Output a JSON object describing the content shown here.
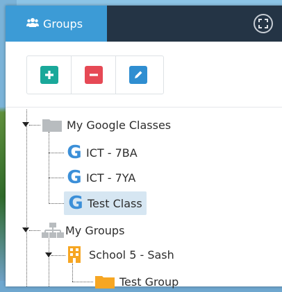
{
  "header": {
    "tab_label": "Groups",
    "tab_icon": "users-icon",
    "fullscreen_icon": "fullscreen-icon"
  },
  "toolbar": {
    "add_icon": "plus-icon",
    "remove_icon": "minus-icon",
    "edit_icon": "pencil-icon"
  },
  "tree": {
    "google_classes": {
      "label": "My Google Classes",
      "children": [
        "ICT - 7BA",
        "ICT - 7YA",
        "Test Class"
      ],
      "selected": "Test Class"
    },
    "groups": {
      "label": "My Groups",
      "school": {
        "label": "School 5 - Sash",
        "children": [
          "Test Group"
        ]
      }
    }
  },
  "colors": {
    "header_bg": "#243445",
    "tab_active": "#3c9bd6",
    "add": "#1aa89a",
    "remove": "#e64955",
    "edit": "#2f8ed1",
    "google": "#3b8fd8",
    "folder_grey": "#b8bcbf",
    "folder_orange": "#f6a623"
  }
}
